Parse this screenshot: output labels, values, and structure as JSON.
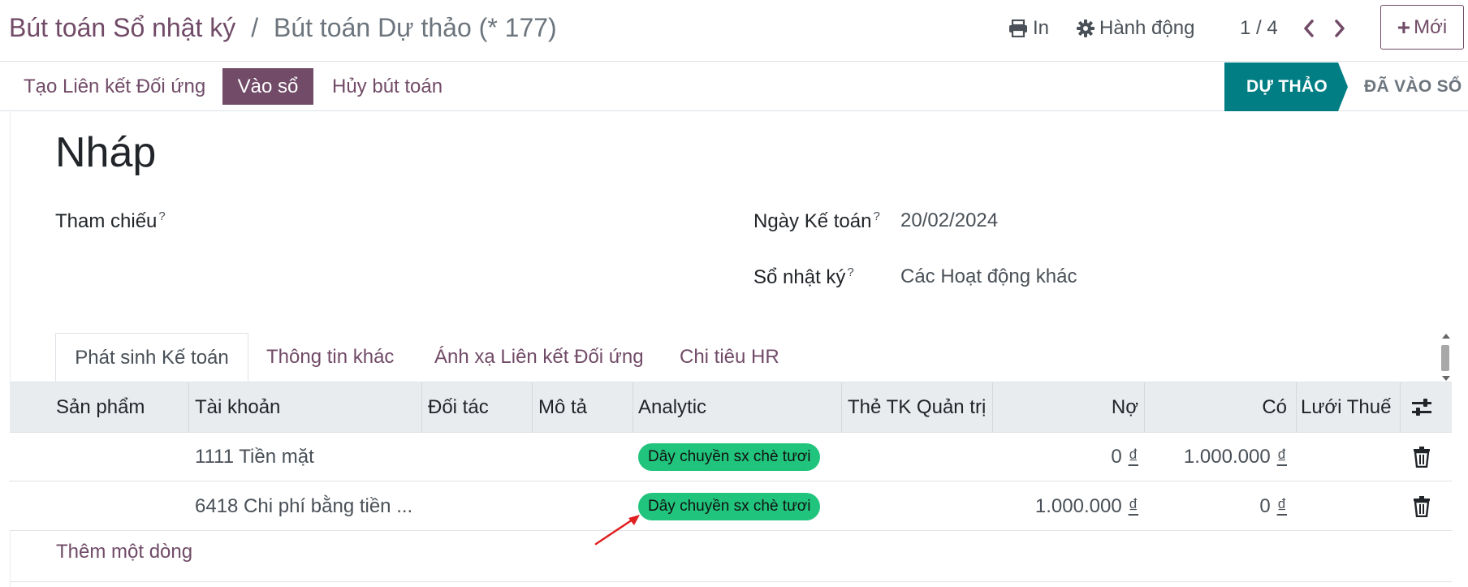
{
  "breadcrumb": {
    "parent": "Bút toán Sổ nhật ký",
    "separator": "/",
    "current": "Bút toán Dự thảo (* 177)"
  },
  "actions": {
    "print_label": "In",
    "action_label": "Hành động",
    "new_label": "Mới"
  },
  "pager": {
    "value": "1 / 4"
  },
  "statusbar": {
    "buttons": {
      "reconcile": "Tạo Liên kết Đối ứng",
      "post": "Vào sổ",
      "cancel": "Hủy bút toán"
    },
    "stages": {
      "draft": "DỰ THẢO",
      "posted": "ĐÃ VÀO SỔ"
    }
  },
  "record": {
    "title": "Nháp",
    "fields": {
      "reference_label": "Tham chiếu",
      "date_label": "Ngày Kế toán",
      "date_value": "20/02/2024",
      "journal_label": "Sổ nhật ký",
      "journal_value": "Các Hoạt động khác",
      "help_marker": "?"
    }
  },
  "tabs": {
    "t1": "Phát sinh Kế toán",
    "t2": "Thông tin khác",
    "t3": "Ánh xạ Liên kết Đối ứng",
    "t4": "Chi tiêu HR"
  },
  "table": {
    "headers": {
      "product": "Sản phẩm",
      "account": "Tài khoản",
      "partner": "Đối tác",
      "label": "Mô tả",
      "analytic": "Analytic",
      "tags": "Thẻ TK Quản trị",
      "debit": "Nợ",
      "credit": "Có",
      "tax_grid": "Lưới Thuế"
    },
    "rows": [
      {
        "account": "1111 Tiền mặt",
        "analytic": "Dây chuyền sx chè tươi",
        "debit": "0",
        "credit": "1.000.000"
      },
      {
        "account": "6418 Chi phí bằng tiền ...",
        "analytic": "Dây chuyền sx chè tươi",
        "debit": "1.000.000",
        "credit": "0"
      }
    ],
    "currency_symbol": "₫",
    "add_line": "Thêm một dòng"
  },
  "colors": {
    "brand": "#714b67",
    "stage_active": "#017e84",
    "tag": "#21c47c",
    "annotation": "#e02020"
  }
}
